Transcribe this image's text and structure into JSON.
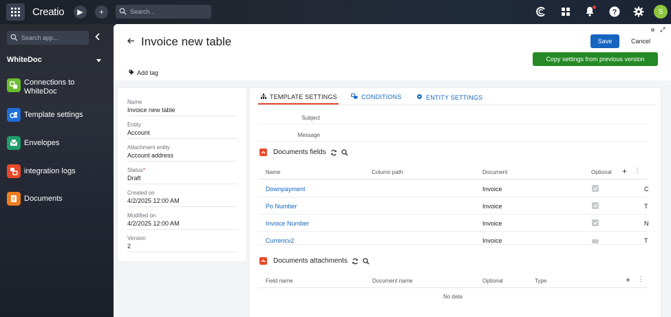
{
  "topbar": {
    "brand": "Creatio",
    "search_placeholder": "Search...",
    "avatar_initial": "S"
  },
  "sidebar": {
    "search_placeholder": "Search app...",
    "workspace": "WhiteDoc",
    "items": [
      {
        "label": "Connections to WhiteDoc",
        "icon": "link-icon",
        "color": "#6bbd2e"
      },
      {
        "label": "Template settings",
        "icon": "template-icon",
        "color": "#1e6fd9"
      },
      {
        "label": "Envelopes",
        "icon": "envelope-icon",
        "color": "#1f9d6a"
      },
      {
        "label": "integration logs",
        "icon": "log-icon",
        "color": "#e8492a"
      },
      {
        "label": "Documents",
        "icon": "document-icon",
        "color": "#f07c1f"
      }
    ]
  },
  "header": {
    "title": "Invoice new table",
    "save_label": "Save",
    "cancel_label": "Cancel",
    "copy_label": "Copy settings from previous version",
    "add_tag_label": "Add tag"
  },
  "info": {
    "fields": [
      {
        "label": "Name",
        "value": "Invoice new table",
        "required": false
      },
      {
        "label": "Entity",
        "value": "Account",
        "required": false
      },
      {
        "label": "Attachment entity",
        "value": "Account address",
        "required": false
      },
      {
        "label": "Status",
        "value": "Draft",
        "required": true
      },
      {
        "label": "Created on",
        "value": "4/2/2025 12:00 AM",
        "required": false
      },
      {
        "label": "Modified on",
        "value": "4/2/2025 12:00 AM",
        "required": false
      },
      {
        "label": "Version",
        "value": "2",
        "required": false
      }
    ],
    "required_mark": "*"
  },
  "tabs": [
    {
      "label": "TEMPLATE SETTINGS",
      "icon": "hierarchy-icon",
      "active": true
    },
    {
      "label": "CONDITIONS",
      "icon": "conditions-icon",
      "active": false
    },
    {
      "label": "ENTITY SETTINGS",
      "icon": "gear-icon",
      "active": false
    }
  ],
  "template": {
    "subject_label": "Subject",
    "message_label": "Message"
  },
  "documents_fields": {
    "title": "Documents fields",
    "columns": [
      "Name",
      "Column path",
      "Document",
      "Optional"
    ],
    "rows": [
      {
        "name": "Downpayment",
        "document": "Invoice",
        "cut": "C"
      },
      {
        "name": "Po Number",
        "document": "Invoice",
        "cut": "T"
      },
      {
        "name": "Invoice Number",
        "document": "Invoice",
        "cut": "N"
      },
      {
        "name": "Currencv2",
        "document": "Invoice",
        "cut": "T"
      }
    ]
  },
  "documents_attachments": {
    "title": "Documents attachments",
    "columns": [
      "Field name",
      "Document name",
      "Optional",
      "Type"
    ],
    "empty_text": "No data"
  }
}
